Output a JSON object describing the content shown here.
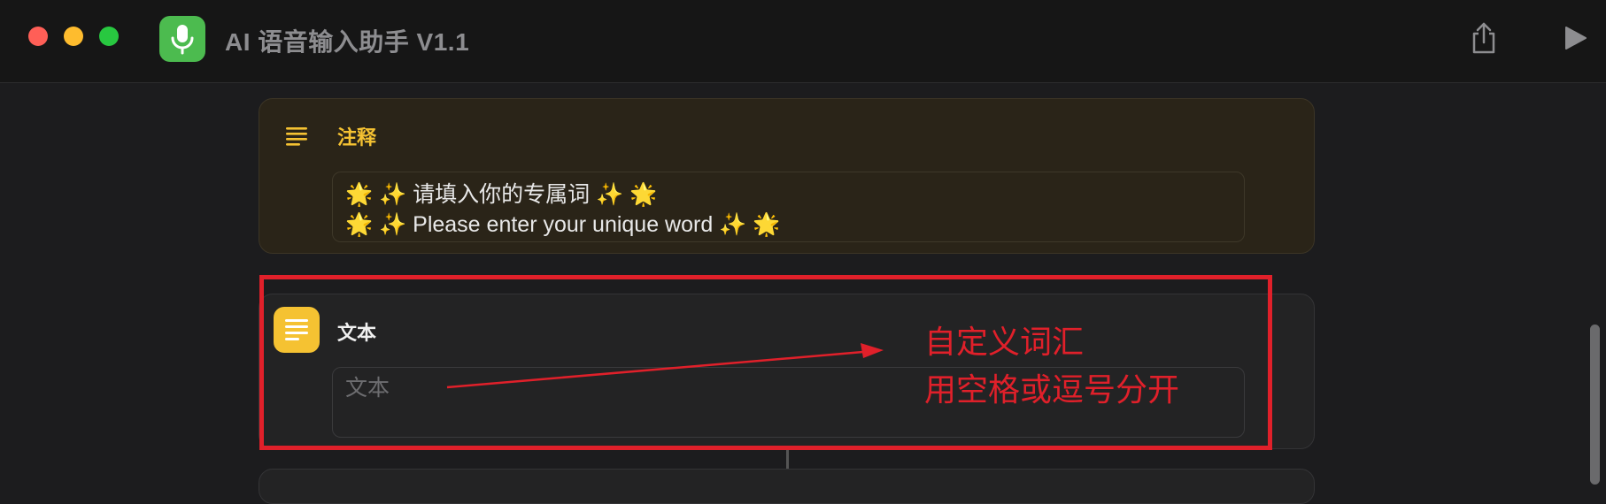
{
  "window": {
    "title": "AI 语音输入助手 V1.1",
    "app_icon": "microphone-icon",
    "toolbar_icons": [
      "share-icon",
      "play-icon"
    ],
    "traffic_lights": {
      "close": "#ff5f57",
      "minimize": "#febc2e",
      "zoom": "#28c840"
    }
  },
  "comment_action": {
    "title": "注释",
    "icon": "text-lines-icon",
    "accent": "#f5c232",
    "lines": [
      "🌟 ✨ 请填入你的专属词 ✨ 🌟",
      "🌟 ✨ Please enter your unique word ✨ 🌟"
    ]
  },
  "text_action": {
    "title": "文本",
    "icon": "text-document-icon",
    "accent": "#f5c232",
    "placeholder": "文本"
  },
  "annotation": {
    "color": "#e0202a",
    "line1": "自定义词汇",
    "line2": "用空格或逗号分开"
  }
}
